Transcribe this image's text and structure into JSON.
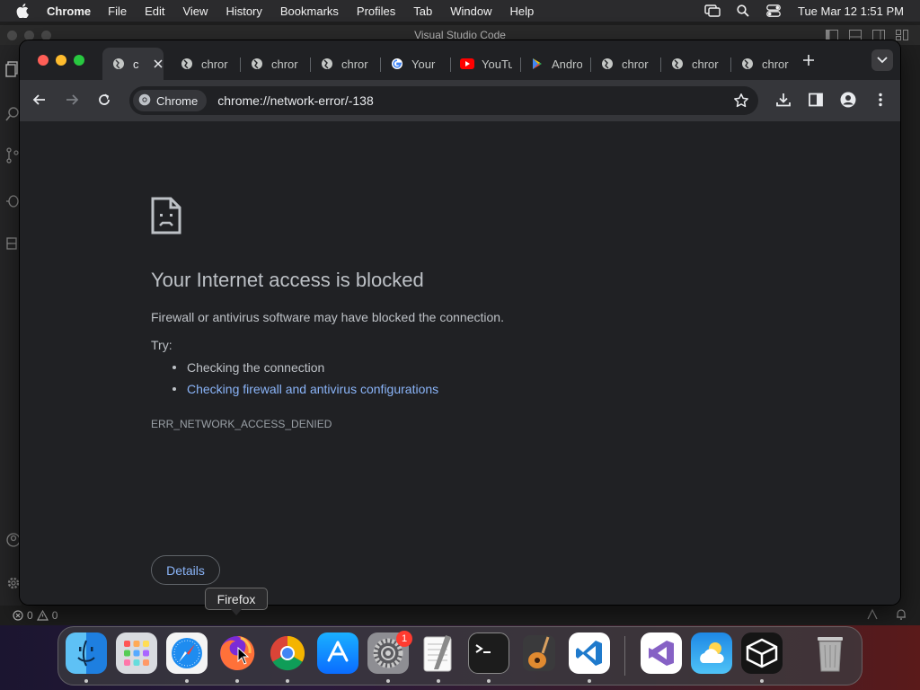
{
  "menubar": {
    "app_name": "Chrome",
    "items": [
      "File",
      "Edit",
      "View",
      "History",
      "Bookmarks",
      "Profiles",
      "Tab",
      "Window",
      "Help"
    ],
    "clock": "Tue Mar 12  1:51 PM"
  },
  "vscode": {
    "title": "Visual Studio Code",
    "status_errors": "0",
    "status_warnings": "0"
  },
  "chrome": {
    "tabs": [
      {
        "title": "c",
        "icon": "globe-icon",
        "active": true
      },
      {
        "title": "chror",
        "icon": "globe-icon"
      },
      {
        "title": "chror",
        "icon": "globe-icon"
      },
      {
        "title": "chror",
        "icon": "globe-icon"
      },
      {
        "title": "Your",
        "icon": "google-icon"
      },
      {
        "title": "YouTu",
        "icon": "youtube-icon"
      },
      {
        "title": "Andro",
        "icon": "play-store-icon"
      },
      {
        "title": "chror",
        "icon": "globe-icon"
      },
      {
        "title": "chror",
        "icon": "globe-icon"
      },
      {
        "title": "chror",
        "icon": "globe-icon"
      }
    ],
    "omnibox": {
      "chip_label": "Chrome",
      "url": "chrome://network-error/-138"
    }
  },
  "error_page": {
    "title": "Your Internet access is blocked",
    "description": "Firewall or antivirus software may have blocked the connection.",
    "try_label": "Try:",
    "suggestions": [
      {
        "text": "Checking the connection",
        "link": false
      },
      {
        "text": "Checking firewall and antivirus configurations",
        "link": true
      }
    ],
    "error_code": "ERR_NETWORK_ACCESS_DENIED",
    "details_button": "Details"
  },
  "tooltip": {
    "text": "Firefox"
  },
  "dock": {
    "apps": [
      "Finder",
      "Launchpad",
      "Safari",
      "Firefox",
      "Google Chrome",
      "App Store",
      "System Settings",
      "TextEdit",
      "Terminal",
      "GarageBand",
      "Visual Studio Code",
      "Visual Studio",
      "Weather",
      "CodeSandbox",
      "Trash"
    ],
    "settings_badge": "1"
  },
  "colors": {
    "link": "#8ab4f8",
    "chrome_bg": "#202124",
    "toolbar_bg": "#35363a",
    "close": "#ff5f57",
    "minimize": "#febc2e",
    "zoom": "#28c840"
  }
}
